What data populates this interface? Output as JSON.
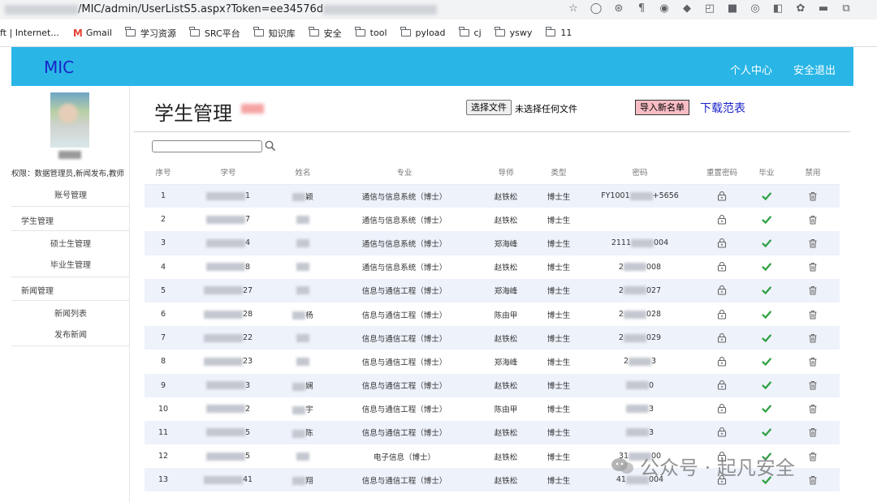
{
  "browser": {
    "url_visible": "/MIC/admin/UserListS5.aspx?Token=ee34576d",
    "bookmarks": [
      "ft | Internet...",
      "Gmail",
      "学习资源",
      "SRC平台",
      "知识库",
      "安全",
      "tool",
      "pyload",
      "cj",
      "yswy",
      "11"
    ]
  },
  "header": {
    "logo": "MIC",
    "nav": [
      "个人中心",
      "安全退出"
    ]
  },
  "sidebar": {
    "permission": "权限：数据管理员,新闻发布,教师",
    "account_mgmt": "账号管理",
    "student_mgmt": "学生管理",
    "master_mgmt": "硕士生管理",
    "graduate_mgmt": "毕业生管理",
    "news_mgmt": "新闻管理",
    "news_list": "新闻列表",
    "publish_news": "发布新闻"
  },
  "main": {
    "title": "学生管理",
    "file_button": "选择文件",
    "file_status": "未选择任何文件",
    "import_button": "导入新名单",
    "download_link": "下载范表"
  },
  "table": {
    "headers": [
      "序号",
      "学号",
      "姓名",
      "专业",
      "导师",
      "类型",
      "密码",
      "重置密码",
      "毕业",
      "禁用"
    ],
    "rows": [
      {
        "no": "1",
        "id_tail": "1",
        "name": "颖",
        "major": "通信与信息系统（博士）",
        "advisor": "赵铁松",
        "type": "博士生",
        "pw": "FY1001",
        "pw_tail": "+5656"
      },
      {
        "no": "2",
        "id_tail": "7",
        "name": "",
        "major": "通信与信息系统（博士）",
        "advisor": "赵铁松",
        "type": "博士生",
        "pw": "",
        "pw_tail": ""
      },
      {
        "no": "3",
        "id_tail": "4",
        "name": "",
        "major": "通信与信息系统（博士）",
        "advisor": "郑海峰",
        "type": "博士生",
        "pw": "2111",
        "pw_tail": "004"
      },
      {
        "no": "4",
        "id_tail": "8",
        "name": "",
        "major": "通信与信息系统（博士）",
        "advisor": "赵铁松",
        "type": "博士生",
        "pw": "2",
        "pw_tail": "008"
      },
      {
        "no": "5",
        "id_tail": "27",
        "name": "",
        "major": "信息与通信工程（博士）",
        "advisor": "郑海峰",
        "type": "博士生",
        "pw": "2",
        "pw_tail": "027"
      },
      {
        "no": "6",
        "id_tail": "28",
        "name": "杨",
        "major": "信息与通信工程（博士）",
        "advisor": "陈由甲",
        "type": "博士生",
        "pw": "2",
        "pw_tail": "028"
      },
      {
        "no": "7",
        "id_tail": "22",
        "name": "",
        "major": "信息与通信工程（博士）",
        "advisor": "赵铁松",
        "type": "博士生",
        "pw": "2",
        "pw_tail": "029"
      },
      {
        "no": "8",
        "id_tail": "23",
        "name": "",
        "major": "信息与通信工程（博士）",
        "advisor": "郑海峰",
        "type": "博士生",
        "pw": "2",
        "pw_tail": "3"
      },
      {
        "no": "9",
        "id_tail": "3",
        "name": "娴",
        "major": "信息与通信工程（博士）",
        "advisor": "赵铁松",
        "type": "博士生",
        "pw": "",
        "pw_tail": "0"
      },
      {
        "no": "10",
        "id_tail": "2",
        "name": "宇",
        "major": "信息与通信工程（博士）",
        "advisor": "陈由甲",
        "type": "博士生",
        "pw": "",
        "pw_tail": "3"
      },
      {
        "no": "11",
        "id_tail": "5",
        "name": "陈",
        "major": "信息与通信工程（博士）",
        "advisor": "赵铁松",
        "type": "博士生",
        "pw": "",
        "pw_tail": "3"
      },
      {
        "no": "12",
        "id_tail": "5",
        "name": "",
        "major": "电子信息（博士）",
        "advisor": "赵铁松",
        "type": "博士生",
        "pw": "31",
        "pw_tail": "00"
      },
      {
        "no": "13",
        "id_tail": "41",
        "name": "翔",
        "major": "信息与通信工程（博士）",
        "advisor": "赵铁松",
        "type": "博士生",
        "pw": "41",
        "pw_tail": "004"
      }
    ]
  },
  "watermark": "公众号 · 起凡安全",
  "colors": {
    "header_bg": "#29b6e6",
    "logo": "#1a23c8",
    "row_alt": "#eef2fb",
    "check": "#2ea043"
  }
}
